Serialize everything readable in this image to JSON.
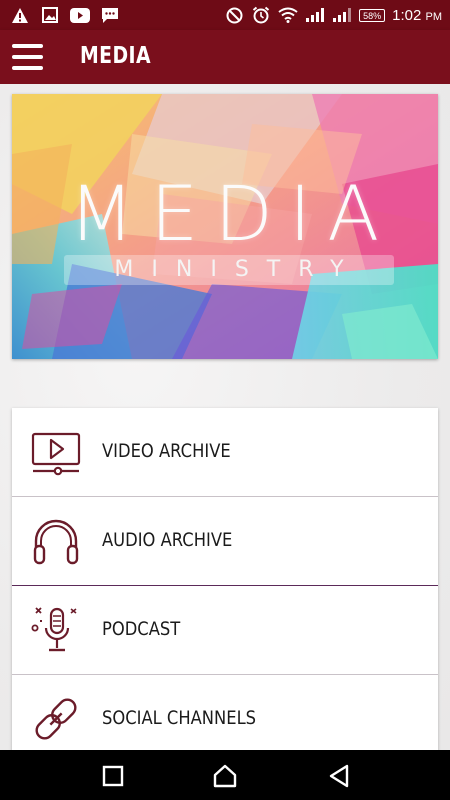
{
  "status_bar": {
    "left_icons": [
      "warning-icon",
      "image-icon",
      "youtube-icon",
      "message-icon"
    ],
    "right_icons": [
      "do-not-disturb-icon",
      "alarm-icon",
      "wifi-icon",
      "signal-icon",
      "signal-icon"
    ],
    "battery": "58%",
    "time": "1:02",
    "ampm": "PM"
  },
  "app_bar": {
    "title": "MEDIA",
    "menu_icon": "hamburger-menu-icon"
  },
  "banner": {
    "title": "MEDIA",
    "subtitle": "MINISTRY"
  },
  "menu": {
    "items": [
      {
        "label": "VIDEO ARCHIVE",
        "icon": "video-player-icon"
      },
      {
        "label": "AUDIO ARCHIVE",
        "icon": "headphones-icon"
      },
      {
        "label": "PODCAST",
        "icon": "microphone-icon"
      },
      {
        "label": "SOCIAL CHANNELS",
        "icon": "chain-link-icon"
      }
    ]
  },
  "nav_bar": {
    "buttons": [
      "recents-square-icon",
      "home-icon",
      "back-triangle-icon"
    ]
  },
  "colors": {
    "status_bar": "#6e0b16",
    "app_bar": "#7a0f1c",
    "icon_accent": "#6b1c2a"
  }
}
